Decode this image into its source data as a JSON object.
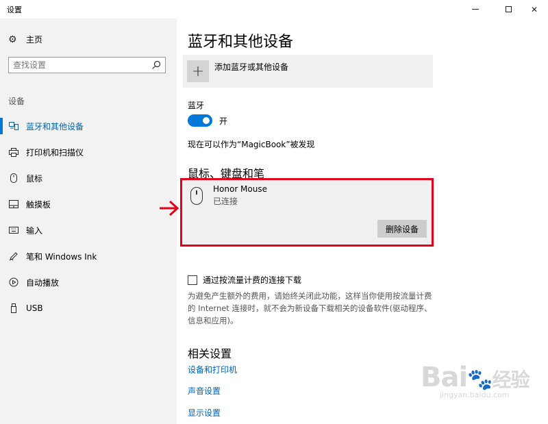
{
  "window": {
    "title": "设置",
    "min_icon": "minimize-icon",
    "max_icon": "maximize-icon",
    "close_glyph": "✕"
  },
  "sidebar": {
    "home_label": "主页",
    "search_placeholder": "查找设置",
    "section_label": "设备",
    "items": [
      {
        "label": "蓝牙和其他设备",
        "icon": "bluetooth-devices-icon",
        "active": true
      },
      {
        "label": "打印机和扫描仪",
        "icon": "printer-icon",
        "active": false
      },
      {
        "label": "鼠标",
        "icon": "mouse-icon",
        "active": false
      },
      {
        "label": "触摸板",
        "icon": "touchpad-icon",
        "active": false
      },
      {
        "label": "输入",
        "icon": "keyboard-icon",
        "active": false
      },
      {
        "label": "笔和 Windows Ink",
        "icon": "pen-icon",
        "active": false
      },
      {
        "label": "自动播放",
        "icon": "autoplay-icon",
        "active": false
      },
      {
        "label": "USB",
        "icon": "usb-icon",
        "active": false
      }
    ]
  },
  "main": {
    "title": "蓝牙和其他设备",
    "add_device_label": "添加蓝牙或其他设备",
    "bluetooth_label": "蓝牙",
    "bluetooth_state": "开",
    "discoverable_text": "现在可以作为“MagicBook”被发现",
    "mkp_section_title": "鼠标、键盘和笔",
    "device": {
      "name": "Honor  Mouse",
      "status": "已连接",
      "remove_label": "删除设备"
    },
    "metered_label": "通过按流量计费的连接下载",
    "metered_checked": false,
    "metered_desc": "为避免产生额外的费用，请始终关闭此功能，这样当你使用按流量计费的 Internet 连接时，就不会为新设备下载相关的设备软件(驱动程序、信息和应用)。",
    "related_title": "相关设置",
    "related_links": [
      "设备和打印机",
      "声音设置",
      "显示设置"
    ]
  },
  "watermark": {
    "main": "Bai",
    "paw": "🐾",
    "suffix": "经验",
    "sub": "jingyan.baidu.com"
  },
  "colors": {
    "accent": "#0078d7",
    "link": "#0063b1",
    "highlight_box": "#e3001b",
    "sidebar_bg": "#f2f2f2"
  }
}
